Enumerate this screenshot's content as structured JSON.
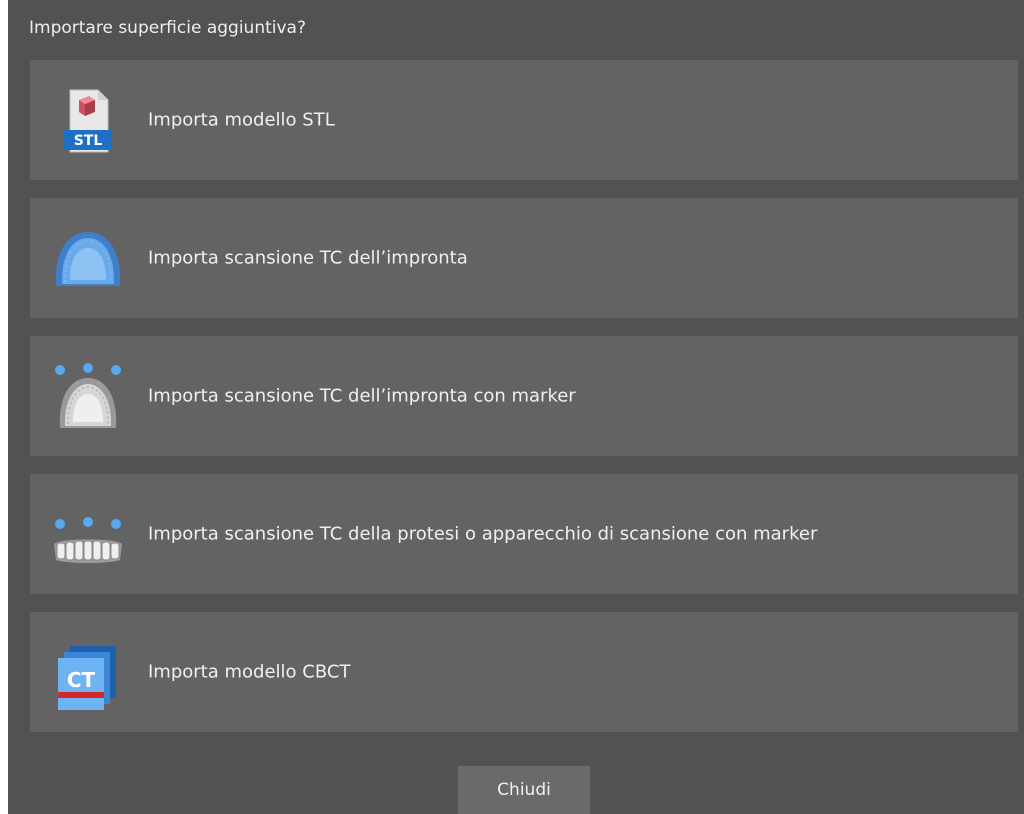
{
  "dialog": {
    "title": "Importare superficie aggiuntiva?",
    "close_label": "Chiudi"
  },
  "options": [
    {
      "label": "Importa modello STL",
      "icon": "stl-file-icon"
    },
    {
      "label": "Importa scansione TC dell’impronta",
      "icon": "impression-scan-icon"
    },
    {
      "label": "Importa scansione TC dell’impronta con marker",
      "icon": "impression-markers-icon"
    },
    {
      "label": "Importa scansione TC della protesi o apparecchio di scansione con marker",
      "icon": "denture-markers-icon"
    },
    {
      "label": "Importa modello CBCT",
      "icon": "ct-model-icon"
    }
  ],
  "icon_text": {
    "stl": "STL",
    "ct": "CT"
  },
  "colors": {
    "dialog_bg": "#525252",
    "option_bg": "#636363",
    "marker_blue": "#5aa8f0",
    "stl_blue": "#1f6fc4",
    "stl_red": "#c9545f"
  }
}
